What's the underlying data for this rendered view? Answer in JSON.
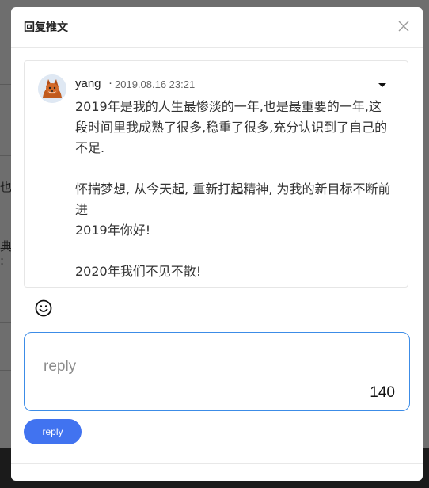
{
  "modal": {
    "title": "回复推文",
    "close_icon": "close-icon"
  },
  "tweet": {
    "author": "yang",
    "separator": "·",
    "timestamp": "2019.08.16 23:21",
    "menu_icon": "caret-down-icon",
    "text": "2019年是我的人生最惨淡的一年,也是最重要的一年,这段时间里我成熟了很多,稳重了很多,充分认识到了自己的不足.\n\n怀揣梦想, 从今天起, 重新打起精神, 为我的新目标不断前进\n2019年你好!\n\n2020年我们不见不散!"
  },
  "composer": {
    "emoji_icon": "smiley-face-icon",
    "placeholder": "reply",
    "value": "",
    "remaining_chars": "140",
    "submit_label": "reply"
  },
  "background": {
    "fragments": [
      "也",
      "典, :"
    ]
  },
  "colors": {
    "accent": "#4173f0",
    "input_border": "#3c8ce7",
    "overlay": "#6e6e6e"
  }
}
